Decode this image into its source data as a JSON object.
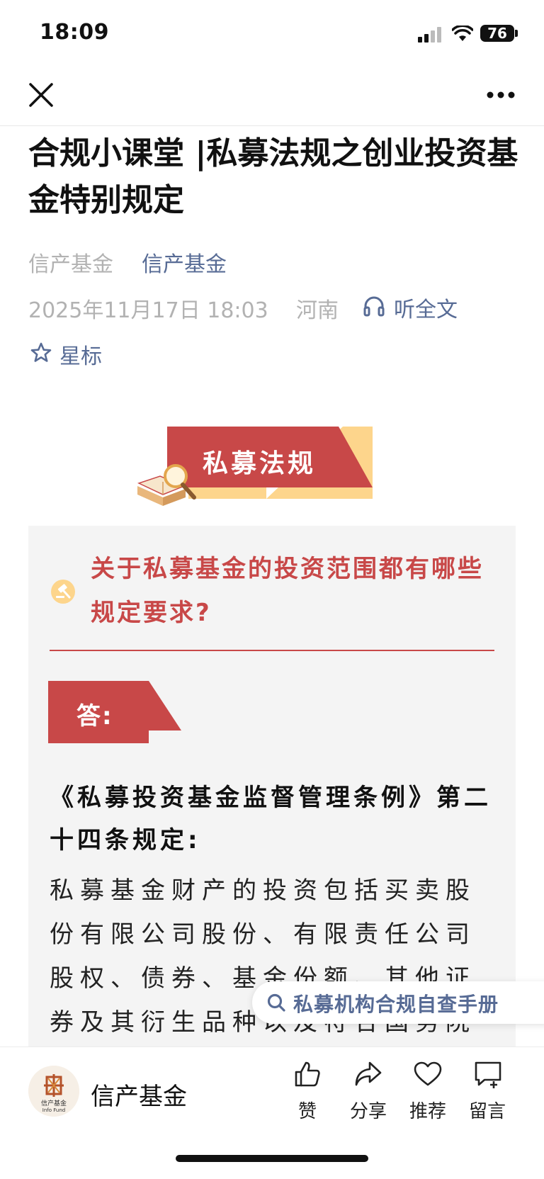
{
  "status_bar": {
    "time": "18:09",
    "battery": "76"
  },
  "article": {
    "title": "合规小课堂 |私募法规之创业投资基金特别规定",
    "author": "信产基金",
    "account": "信产基金",
    "datetime": "2025年11月17日 18:03",
    "location": "河南",
    "listen_label": "听全文",
    "star_label": "星标"
  },
  "banner": {
    "label": "私募法规"
  },
  "content": {
    "question": "关于私募基金的投资范围都有哪些规定要求?",
    "answer_label": "答:",
    "law_title": "《私募投资基金监督管理条例》第二十四条规定:",
    "law_body": "私募基金财产的投资包括买卖股份有限公司股份、有限责任公司股权、债券、基金份额、其他证券及其衍生品种以及符合国务院"
  },
  "search_pill": {
    "label": "私募机构合规自查手册"
  },
  "bottom_bar": {
    "account_name": "信产基金",
    "avatar_text_cn": "信产基金",
    "avatar_text_en": "Info Fund",
    "actions": [
      "赞",
      "分享",
      "推荐",
      "留言"
    ]
  },
  "colors": {
    "accent_red": "#c84848",
    "link_blue": "#576b95",
    "meta_gray": "#b2b2b2",
    "yellow": "#fdd58c"
  }
}
